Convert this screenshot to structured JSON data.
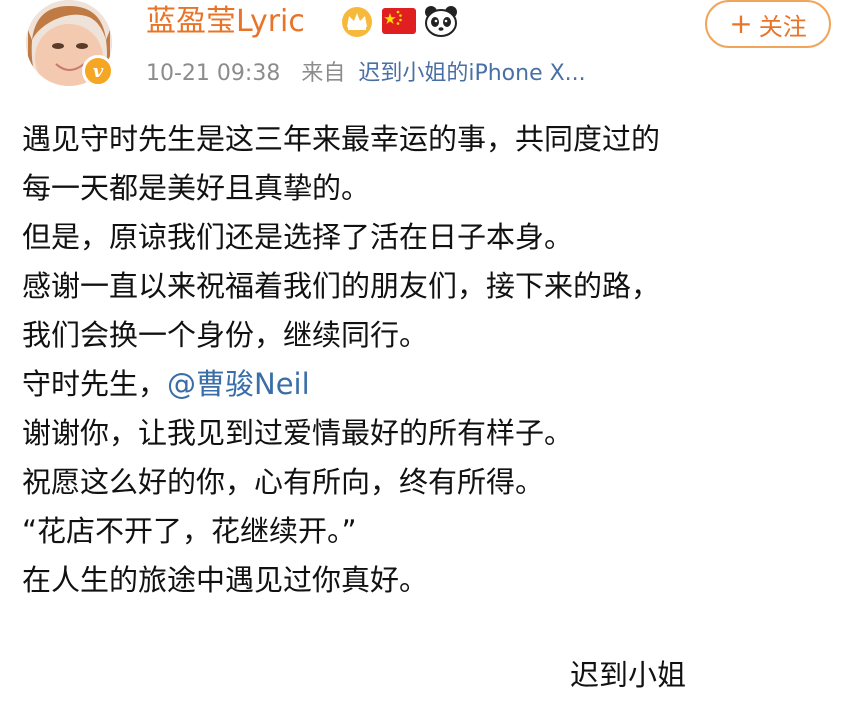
{
  "post": {
    "author": {
      "avatar_icon": "avatar-photo",
      "verified_icon": "verified-v-icon",
      "verified_glyph": "v",
      "name": "蓝盈莹Lyric",
      "name_color": "#e8742a",
      "badges": [
        "crown-icon",
        "china-flag-icon",
        "panda-icon"
      ]
    },
    "meta": {
      "time": "10-21 09:38",
      "from_label": "来自",
      "source": "迟到小姐的iPhone X..."
    },
    "follow_button": {
      "icon": "plus-icon",
      "plus": "+",
      "label": "关注",
      "color": "#e8742a"
    },
    "body": {
      "line1": "遇见守时先生是这三年来最幸运的事，共同度过的",
      "line2": "每一天都是美好且真挚的。",
      "line3": "但是，原谅我们还是选择了活在日子本身。",
      "line4": "感谢一直以来祝福着我们的朋友们，接下来的路，",
      "line5": "我们会换一个身份，继续同行。",
      "line6_prefix": "守时先生，",
      "mention": "@曹骏Neil",
      "line7": "谢谢你，让我见到过爱情最好的所有样子。",
      "line8": "祝愿这么好的你，心有所向，终有所得。",
      "line9": "“花店不开了，花继续开。”",
      "line10": "在人生的旅途中遇见过你真好。"
    },
    "signature": "迟到小姐"
  }
}
